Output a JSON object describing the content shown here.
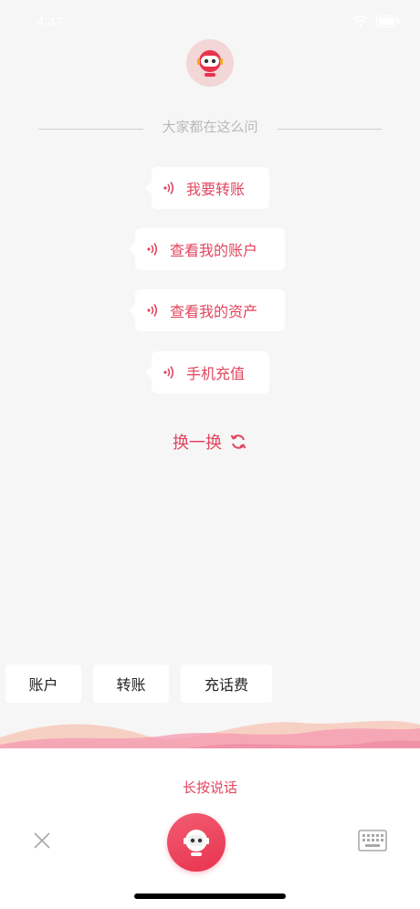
{
  "status": {
    "time": "4:47"
  },
  "header": {
    "title": "大家都在这么问"
  },
  "suggestions": [
    {
      "label": "我要转账"
    },
    {
      "label": "查看我的账户"
    },
    {
      "label": "查看我的资产"
    },
    {
      "label": "手机充值"
    }
  ],
  "refresh": {
    "label": "换一换"
  },
  "quick_chips": [
    {
      "label": "账户"
    },
    {
      "label": "转账"
    },
    {
      "label": "充话费"
    }
  ],
  "voice": {
    "hint": "长按说话"
  },
  "colors": {
    "accent": "#e2455e",
    "background": "#f6f6f6",
    "gray_text": "#b9b9b9"
  },
  "icons": {
    "close": "close-icon",
    "mic": "robot-icon",
    "keyboard": "keyboard-icon",
    "refresh": "refresh-icon",
    "sound": "sound-wave-icon"
  }
}
